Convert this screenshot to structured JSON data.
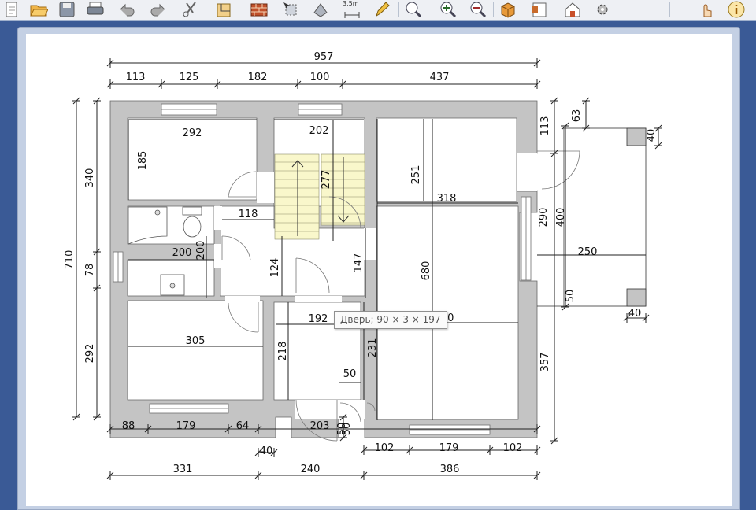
{
  "toolbar": {
    "buttons": [
      {
        "name": "new-plan-icon"
      },
      {
        "name": "open-folder-icon"
      },
      {
        "name": "save-icon"
      },
      {
        "name": "print-icon"
      },
      {
        "name": "undo-icon"
      },
      {
        "name": "redo-icon"
      },
      {
        "name": "cut-icon"
      },
      {
        "name": "plan-create-rooms-icon"
      },
      {
        "name": "create-walls-icon"
      },
      {
        "name": "select-mode-icon"
      },
      {
        "name": "pan-icon"
      },
      {
        "name": "create-dimension-icon"
      },
      {
        "name": "pencil-text-icon"
      },
      {
        "name": "zoom-fit-icon"
      },
      {
        "name": "zoom-in-icon"
      },
      {
        "name": "zoom-out-icon"
      },
      {
        "name": "3d-view-icon"
      },
      {
        "name": "furniture-catalog-icon"
      },
      {
        "name": "house-plugin-icon"
      },
      {
        "name": "settings-gear-icon"
      },
      {
        "name": "hand-pointer-icon"
      },
      {
        "name": "info-icon"
      }
    ],
    "dimension_label": "3,5m"
  },
  "tooltip": "Дверь; 90 × 3 × 197",
  "dimensions": {
    "total_width": "957",
    "top_segments": [
      "113",
      "125",
      "182",
      "100",
      "437"
    ],
    "left_total": "710",
    "left_segments": [
      "340",
      "78",
      "292"
    ],
    "bottom_row1": [
      "88",
      "179",
      "64",
      "203",
      "50",
      "102",
      "179",
      "102"
    ],
    "bottom_row1_extra": [
      "40"
    ],
    "bottom_row2": [
      "331",
      "240",
      "386"
    ],
    "right_segments": [
      "113",
      "357"
    ],
    "porch": [
      "63",
      "40",
      "290",
      "400",
      "250",
      "50",
      "40"
    ],
    "rooms": [
      "292",
      "185",
      "202",
      "277",
      "251",
      "318",
      "118",
      "200",
      "200",
      "124",
      "147",
      "680",
      "192",
      "330",
      "305",
      "218",
      "231",
      "50",
      "50"
    ]
  },
  "colors": {
    "wall": "#c4c4c4",
    "stairs": "#f9f7cb",
    "background": "#3a5a96",
    "toolbar": "#eef0f4"
  }
}
